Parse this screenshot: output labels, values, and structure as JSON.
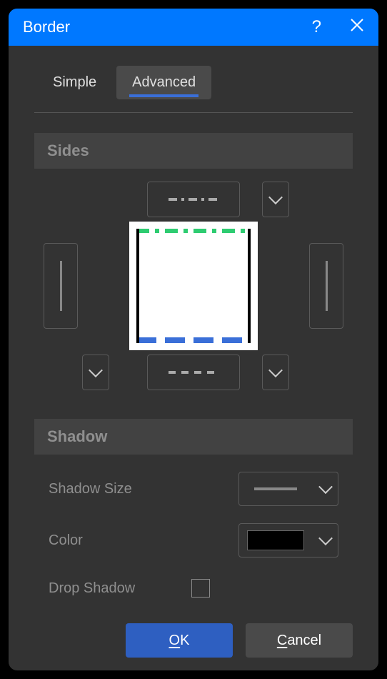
{
  "title": "Border",
  "tabs": {
    "simple": "Simple",
    "advanced": "Advanced",
    "active": "advanced"
  },
  "sections": {
    "sides": "Sides",
    "shadow": "Shadow"
  },
  "shadow": {
    "size_label": "Shadow Size",
    "color_label": "Color",
    "drop_label": "Drop Shadow",
    "color_value": "#000000"
  },
  "buttons": {
    "ok": "OK",
    "cancel": "Cancel"
  },
  "border_preview": {
    "top": {
      "style": "dash-dot",
      "color": "#2ecc71"
    },
    "bottom": {
      "style": "dashed",
      "color": "#3a6fd8"
    },
    "left": {
      "style": "solid",
      "color": "#000000"
    },
    "right": {
      "style": "solid",
      "color": "#000000"
    }
  }
}
